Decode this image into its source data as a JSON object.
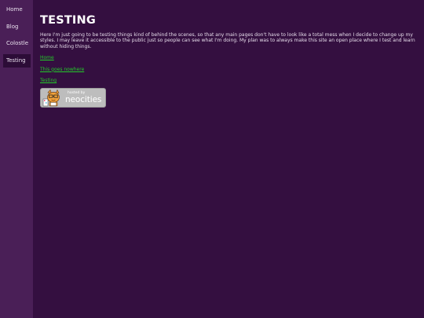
{
  "sidebar": {
    "items": [
      {
        "label": "Home",
        "active": false
      },
      {
        "label": "Blog",
        "active": false
      },
      {
        "label": "Colostle",
        "active": false
      },
      {
        "label": "Testing",
        "active": true
      }
    ]
  },
  "main": {
    "title": "TESTING",
    "intro": "Here I'm just going to be testing things kind of behind the scenes, so that any main pages don't have to look like a total mess when I decide to change up my styles. I may leave it accessible to the public just so people can see what I'm doing. My plan was to always make this site an open place where I test and learn without hiding things.",
    "links": [
      "Home",
      "This goes nowhere",
      "Testing"
    ],
    "badge": {
      "small_text": "hosted by",
      "brand_text": "neocities",
      "icon": "neocities-cat-icon"
    }
  },
  "colors": {
    "page_background": "#340f40",
    "sidebar_background": "#4a1f57",
    "active_nav_background": "#2c0c37",
    "link": "#23cc29"
  }
}
